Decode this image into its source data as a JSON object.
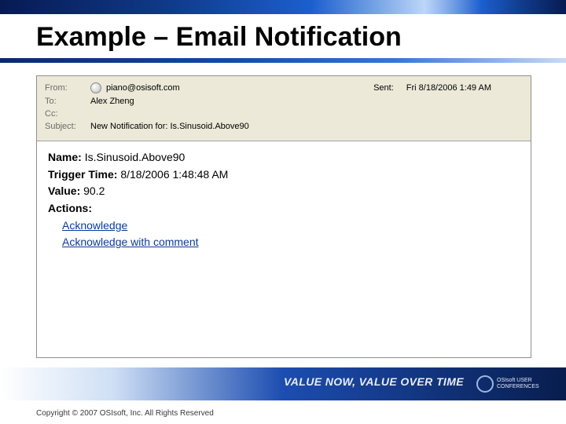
{
  "slide": {
    "title": "Example – Email Notification",
    "copyright": "Copyright © 2007 OSIsoft, Inc. All Rights Reserved"
  },
  "band": {
    "slogan": "VALUE NOW, VALUE OVER TIME",
    "conference_line1": "OSIsoft USER",
    "conference_line2": "CONFERENCES"
  },
  "email": {
    "from_label": "From:",
    "from_value": "piano@osisoft.com",
    "sent_label": "Sent:",
    "sent_value": "Fri 8/18/2006 1:49 AM",
    "to_label": "To:",
    "to_value": "Alex Zheng",
    "cc_label": "Cc:",
    "cc_value": "",
    "subject_label": "Subject:",
    "subject_value": "New Notification for: Is.Sinusoid.Above90"
  },
  "body": {
    "name_label": "Name:",
    "name_value": "Is.Sinusoid.Above90",
    "trigger_label": "Trigger Time:",
    "trigger_value": "8/18/2006 1:48:48 AM",
    "value_label": "Value:",
    "value_value": "90.2",
    "actions_label": "Actions:",
    "action1": "Acknowledge",
    "action2": "Acknowledge with comment"
  }
}
